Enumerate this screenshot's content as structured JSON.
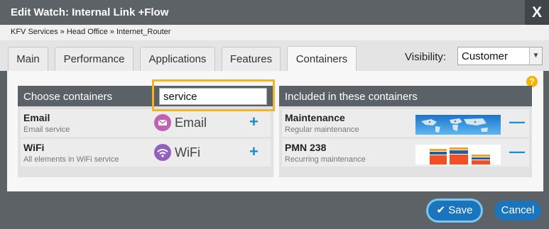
{
  "dialog": {
    "title": "Edit Watch: Internal Link +Flow",
    "close_label": "X",
    "breadcrumb": "KFV Services » Head Office » Internet_Router"
  },
  "tabs": [
    {
      "label": "Main",
      "active": false
    },
    {
      "label": "Performance",
      "active": false
    },
    {
      "label": "Applications",
      "active": false
    },
    {
      "label": "Features",
      "active": false
    },
    {
      "label": "Containers",
      "active": true
    }
  ],
  "visibility": {
    "label": "Visibility:",
    "value": "Customer"
  },
  "help_label": "?",
  "choose": {
    "title": "Choose containers",
    "search_value": "service",
    "items": [
      {
        "name": "Email",
        "description": "Email service",
        "logo_text": "Email",
        "logo_icon": "envelope-icon",
        "logo_color": "#c061b4",
        "action": "+"
      },
      {
        "name": "WiFi",
        "description": "All elements in WiFi service",
        "logo_text": "WiFi",
        "logo_icon": "wifi-icon",
        "logo_color": "#9460c0",
        "action": "+"
      }
    ]
  },
  "included": {
    "title": "Included in these containers",
    "items": [
      {
        "name": "Maintenance",
        "description": "Regular maintenance",
        "thumbnail": "world-map-thumbnail",
        "action": "—"
      },
      {
        "name": "PMN 238",
        "description": "Recurring maintenance",
        "thumbnail": "bar-chart-thumbnail",
        "action": "—"
      }
    ]
  },
  "buttons": {
    "save": "Save",
    "cancel": "Cancel"
  },
  "colors": {
    "accent": "#1a75bd",
    "focus_highlight": "#f0b429",
    "header": "#5b6267"
  }
}
